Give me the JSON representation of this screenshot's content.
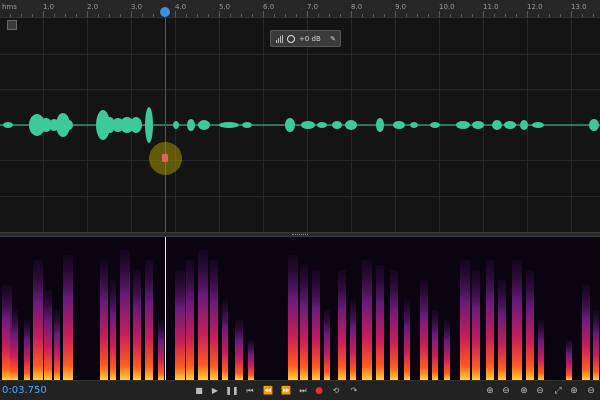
{
  "ruler": {
    "unit": "hms",
    "labels": [
      "1.0",
      "2.0",
      "3.0",
      "4.0",
      "5.0",
      "6.0",
      "7.0",
      "8.0",
      "9.0",
      "10.0",
      "11.0",
      "12.0",
      "13.0"
    ]
  },
  "hud": {
    "gain_value": "+0 dB"
  },
  "transport": {
    "current_time": "0:03.750",
    "buttons": [
      "stop",
      "play",
      "pause",
      "go-to-start",
      "rewind",
      "fast-forward",
      "go-to-end",
      "record",
      "loop",
      "skip-selection"
    ]
  },
  "zoom": {
    "buttons": [
      "zoom-in-amplitude",
      "zoom-out-amplitude",
      "zoom-in-time",
      "zoom-out-time",
      "zoom-full",
      "zoom-in-selection",
      "zoom-out-full"
    ]
  },
  "colors": {
    "waveform": "#3ec99a",
    "playhead": "#c0203a",
    "time_display": "#4aa8ff"
  }
}
